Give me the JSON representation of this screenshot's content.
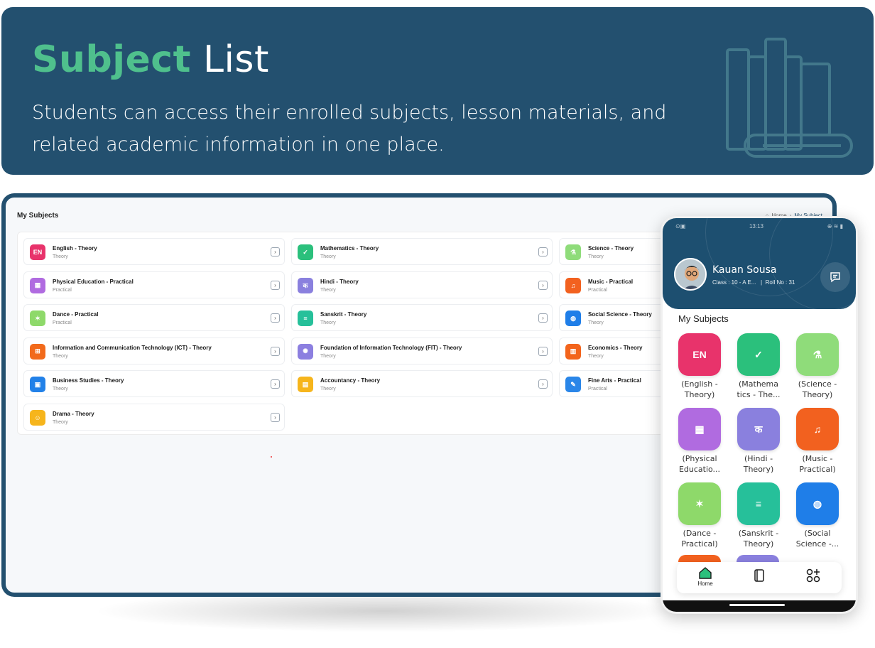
{
  "banner": {
    "title_accent": "Subject",
    "title_rest": " List",
    "description": "Students can access their enrolled subjects, lesson materials, and related academic information in one place."
  },
  "desktop": {
    "title": "My Subjects",
    "breadcrumb": {
      "home": "Home",
      "separator": "›",
      "current": "My Subject"
    },
    "subjects": [
      {
        "name": "English - Theory",
        "type": "Theory",
        "icon": "english-icon",
        "color": "#e8336b",
        "glyph": "EN"
      },
      {
        "name": "Mathematics - Theory",
        "type": "Theory",
        "icon": "math-book-icon",
        "color": "#2bc07c",
        "glyph": "✓"
      },
      {
        "name": "Science - Theory",
        "type": "Theory",
        "icon": "science-icon",
        "color": "#8fdc7a",
        "glyph": "⚗"
      },
      {
        "name": "Physical Education - Practical",
        "type": "Practical",
        "icon": "physical-education-icon",
        "color": "#b06be0",
        "glyph": "▦"
      },
      {
        "name": "Hindi - Theory",
        "type": "Theory",
        "icon": "hindi-book-icon",
        "color": "#8a80de",
        "glyph": "क"
      },
      {
        "name": "Music - Practical",
        "type": "Practical",
        "icon": "guitar-icon",
        "color": "#f2611f",
        "glyph": "♫"
      },
      {
        "name": "Dance - Practical",
        "type": "Practical",
        "icon": "dance-icon",
        "color": "#8ed96a",
        "glyph": "✶"
      },
      {
        "name": "Sanskrit - Theory",
        "type": "Theory",
        "icon": "sanskrit-book-icon",
        "color": "#26c09a",
        "glyph": "≡"
      },
      {
        "name": "Social Science - Theory",
        "type": "Theory",
        "icon": "globe-people-icon",
        "color": "#1f7ee8",
        "glyph": "◍"
      },
      {
        "name": "Information and Communication Technology (ICT) - Theory",
        "type": "Theory",
        "icon": "network-icon",
        "color": "#f26a1b",
        "glyph": "⊞"
      },
      {
        "name": "Foundation of Information Technology (FIT) - Theory",
        "type": "Theory",
        "icon": "gear-chip-icon",
        "color": "#8c7fe0",
        "glyph": "✺"
      },
      {
        "name": "Economics - Theory",
        "type": "Theory",
        "icon": "chart-icon",
        "color": "#f3641c",
        "glyph": "▥"
      },
      {
        "name": "Business Studies - Theory",
        "type": "Theory",
        "icon": "presentation-icon",
        "color": "#2281e8",
        "glyph": "▣"
      },
      {
        "name": "Accountancy - Theory",
        "type": "Theory",
        "icon": "ledger-icon",
        "color": "#f6b51c",
        "glyph": "▤"
      },
      {
        "name": "Fine Arts - Practical",
        "type": "Practical",
        "icon": "easel-icon",
        "color": "#2a86e8",
        "glyph": "✎"
      },
      {
        "name": "Drama - Theory",
        "type": "Theory",
        "icon": "masks-icon",
        "color": "#f6b51c",
        "glyph": "☺"
      }
    ]
  },
  "phone": {
    "status": {
      "left": "⊙▣",
      "time": "13:13",
      "right": "⊕ ≋ ▮"
    },
    "student_name": "Kauan Sousa",
    "class_text": "Class : 10 - A E...",
    "roll_text": "Roll No : 31",
    "section_title": "My Subjects",
    "tiles": [
      {
        "label": "(English - Theory)",
        "color": "#e8336b",
        "glyph": "EN",
        "icon": "english-icon"
      },
      {
        "label": "(Mathema tics - The...",
        "color": "#2bc07c",
        "glyph": "✓",
        "icon": "math-book-icon"
      },
      {
        "label": "(Science - Theory)",
        "color": "#8fdc7a",
        "glyph": "⚗",
        "icon": "science-icon"
      },
      {
        "label": "(Physical Educatio...",
        "color": "#b06be0",
        "glyph": "▦",
        "icon": "physical-education-icon"
      },
      {
        "label": "(Hindi - Theory)",
        "color": "#8a80de",
        "glyph": "क",
        "icon": "hindi-book-icon"
      },
      {
        "label": "(Music - Practical)",
        "color": "#f2611f",
        "glyph": "♫",
        "icon": "guitar-icon"
      },
      {
        "label": "(Dance - Practical)",
        "color": "#8ed96a",
        "glyph": "✶",
        "icon": "dance-icon"
      },
      {
        "label": "(Sanskrit - Theory)",
        "color": "#26c09a",
        "glyph": "≡",
        "icon": "sanskrit-book-icon"
      },
      {
        "label": "(Social Science -...",
        "color": "#1f7ee8",
        "glyph": "◍",
        "icon": "globe-people-icon"
      }
    ],
    "nav": {
      "home": "Home"
    }
  }
}
